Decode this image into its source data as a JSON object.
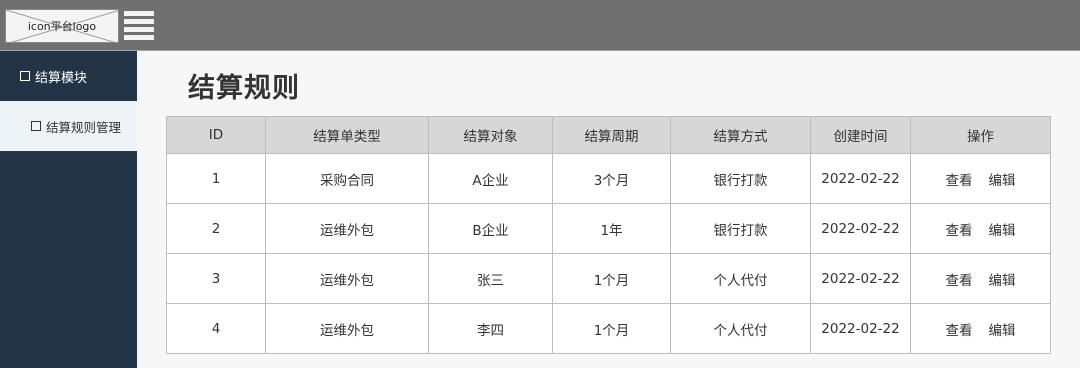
{
  "header": {
    "logo_text": "icon平台logo",
    "menu_icon": "hamburger-menu-icon"
  },
  "sidebar": {
    "group_label": "结算模块",
    "items": [
      {
        "label": "结算规则管理",
        "active": true
      }
    ]
  },
  "page": {
    "title": "结算规则"
  },
  "table": {
    "columns": [
      "ID",
      "结算单类型",
      "结算对象",
      "结算周期",
      "结算方式",
      "创建时间",
      "操作"
    ],
    "rows": [
      {
        "id": "1",
        "type": "采购合同",
        "object": "A企业",
        "cycle": "3个月",
        "method": "银行打款",
        "created": "2022-02-22",
        "view": "查看",
        "edit": "编辑"
      },
      {
        "id": "2",
        "type": "运维外包",
        "object": "B企业",
        "cycle": "1年",
        "method": "银行打款",
        "created": "2022-02-22",
        "view": "查看",
        "edit": "编辑"
      },
      {
        "id": "3",
        "type": "运维外包",
        "object": "张三",
        "cycle": "1个月",
        "method": "个人代付",
        "created": "2022-02-22",
        "view": "查看",
        "edit": "编辑"
      },
      {
        "id": "4",
        "type": "运维外包",
        "object": "李四",
        "cycle": "1个月",
        "method": "个人代付",
        "created": "2022-02-22",
        "view": "查看",
        "edit": "编辑"
      }
    ]
  },
  "colors": {
    "topbar": "#707070",
    "sidebar": "#243447",
    "sidebar_active": "#eef3f7",
    "table_header": "#d7d7d7"
  }
}
